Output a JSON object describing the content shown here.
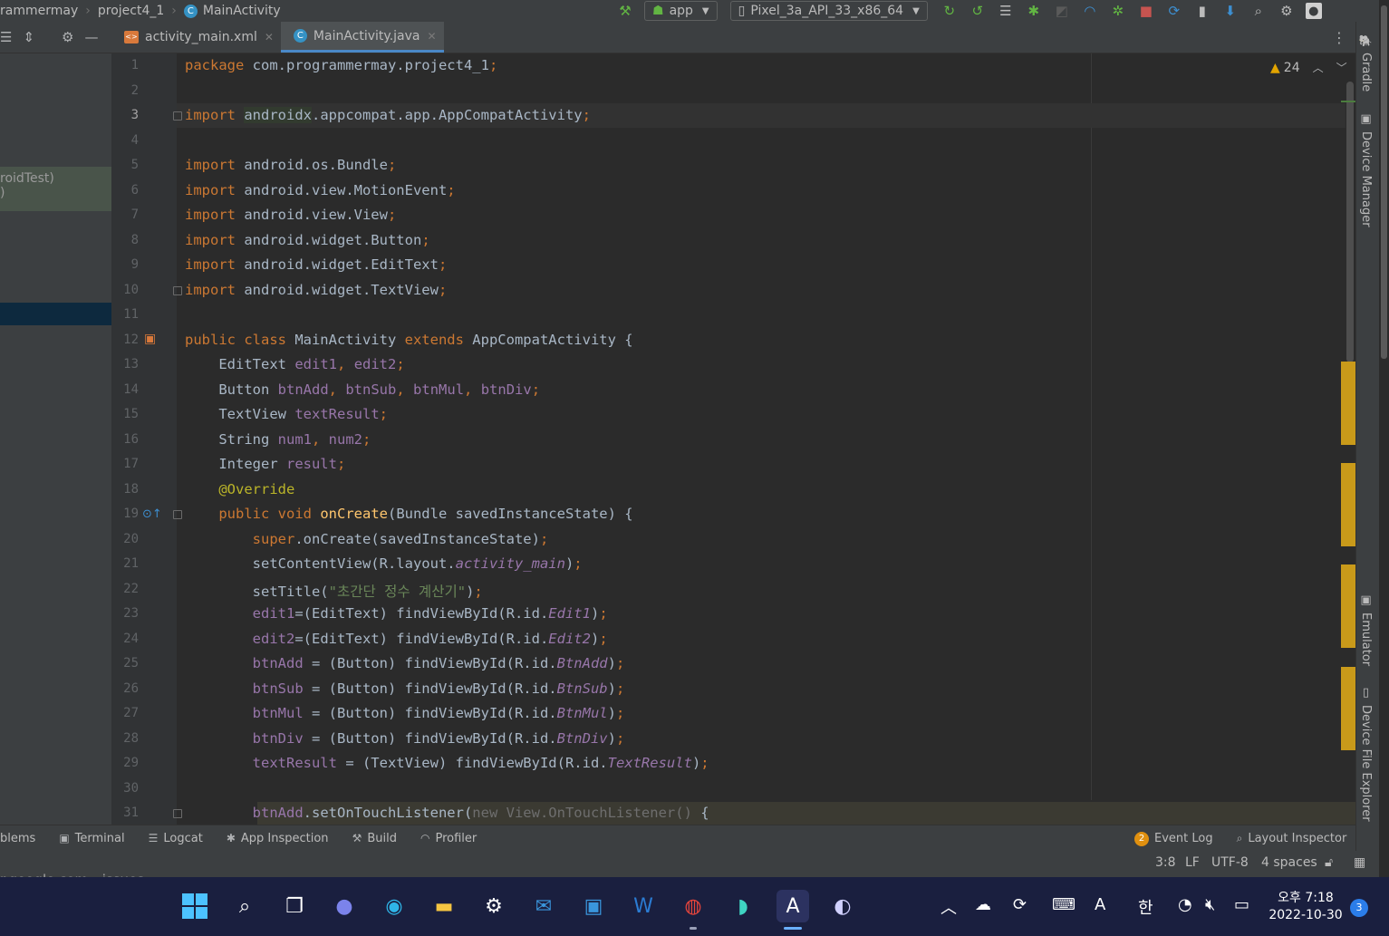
{
  "breadcrumb": [
    "rammermay",
    "project4_1",
    "MainActivity"
  ],
  "toolbar": {
    "run_config": "app",
    "device": "Pixel_3a_API_33_x86_64"
  },
  "left_panel": {
    "test_label": "roidTest)",
    "test_label2": ")"
  },
  "tabs": [
    {
      "label": "activity_main.xml",
      "icon": "xml-layout-icon",
      "active": false
    },
    {
      "label": "MainActivity.java",
      "icon": "java-class-icon",
      "active": true
    }
  ],
  "inspections": {
    "warning_count": "24"
  },
  "lines": [
    {
      "n": "1",
      "html": "<span class=\"k\">package</span> com.programmermay.project4_1<span class=\"k\">;</span>"
    },
    {
      "n": "2",
      "html": ""
    },
    {
      "n": "3",
      "html": "<span class=\"k\">import</span> <span class=\"import-hl\">androidx</span>.appcompat.app.AppCompatActivity<span class=\"k\">;</span>"
    },
    {
      "n": "4",
      "html": ""
    },
    {
      "n": "5",
      "html": "<span class=\"k\">import</span> android.os.Bundle<span class=\"k\">;</span>"
    },
    {
      "n": "6",
      "html": "<span class=\"k\">import</span> android.view.MotionEvent<span class=\"k\">;</span>"
    },
    {
      "n": "7",
      "html": "<span class=\"k\">import</span> android.view.View<span class=\"k\">;</span>"
    },
    {
      "n": "8",
      "html": "<span class=\"k\">import</span> android.widget.Button<span class=\"k\">;</span>"
    },
    {
      "n": "9",
      "html": "<span class=\"k\">import</span> android.widget.EditText<span class=\"k\">;</span>"
    },
    {
      "n": "10",
      "html": "<span class=\"k\">import</span> android.widget.TextView<span class=\"k\">;</span>"
    },
    {
      "n": "11",
      "html": ""
    },
    {
      "n": "12",
      "html": "<span class=\"k\">public class</span> MainActivity <span class=\"k\">extends</span> AppCompatActivity {"
    },
    {
      "n": "13",
      "html": "    EditText <span class=\"f\">edit1</span><span class=\"k\">,</span> <span class=\"f\">edit2</span><span class=\"k\">;</span>"
    },
    {
      "n": "14",
      "html": "    Button <span class=\"f\">btnAdd</span><span class=\"k\">,</span> <span class=\"f\">btnSub</span><span class=\"k\">,</span> <span class=\"f\">btnMul</span><span class=\"k\">,</span> <span class=\"f\">btnDiv</span><span class=\"k\">;</span>"
    },
    {
      "n": "15",
      "html": "    TextView <span class=\"f\">textResult</span><span class=\"k\">;</span>"
    },
    {
      "n": "16",
      "html": "    String <span class=\"f\">num1</span><span class=\"k\">,</span> <span class=\"f\">num2</span><span class=\"k\">;</span>"
    },
    {
      "n": "17",
      "html": "    Integer <span class=\"f\">result</span><span class=\"k\">;</span>"
    },
    {
      "n": "18",
      "html": "    <span class=\"a\">@Override</span>"
    },
    {
      "n": "19",
      "html": "    <span class=\"k\">public void</span> <span class=\"m\">onCreate</span>(Bundle savedInstanceState) {"
    },
    {
      "n": "20",
      "html": "        <span class=\"k\">super</span>.onCreate(savedInstanceState)<span class=\"k\">;</span>"
    },
    {
      "n": "21",
      "html": "        setContentView(R.layout.<span class=\"fi\">activity_main</span>)<span class=\"k\">;</span>"
    },
    {
      "n": "22",
      "html": "        setTitle(<span class=\"s\">\"초간단 정수 계산기\"</span>)<span class=\"k\">;</span>"
    },
    {
      "n": "23",
      "html": "        <span class=\"f\">edit1</span>=(EditText) findViewById(R.id.<span class=\"fi\">Edit1</span>)<span class=\"k\">;</span>"
    },
    {
      "n": "24",
      "html": "        <span class=\"f\">edit2</span>=(EditText) findViewById(R.id.<span class=\"fi\">Edit2</span>)<span class=\"k\">;</span>"
    },
    {
      "n": "25",
      "html": "        <span class=\"f\">btnAdd</span> = (Button) findViewById(R.id.<span class=\"fi\">BtnAdd</span>)<span class=\"k\">;</span>"
    },
    {
      "n": "26",
      "html": "        <span class=\"f\">btnSub</span> = (Button) findViewById(R.id.<span class=\"fi\">BtnSub</span>)<span class=\"k\">;</span>"
    },
    {
      "n": "27",
      "html": "        <span class=\"f\">btnMul</span> = (Button) findViewById(R.id.<span class=\"fi\">BtnMul</span>)<span class=\"k\">;</span>"
    },
    {
      "n": "28",
      "html": "        <span class=\"f\">btnDiv</span> = (Button) findViewById(R.id.<span class=\"fi\">BtnDiv</span>)<span class=\"k\">;</span>"
    },
    {
      "n": "29",
      "html": "        <span class=\"f\">textResult</span> = (TextView) findViewById(R.id.<span class=\"fi\">TextResult</span>)<span class=\"k\">;</span>"
    },
    {
      "n": "30",
      "html": ""
    },
    {
      "n": "31",
      "html": "        <span class=\"f\">btnAdd</span>.setOnTouchListener(<span class=\"g\">new View.OnTouchListener()</span> {"
    }
  ],
  "right_tools": [
    "Gradle",
    "Device Manager",
    "Emulator",
    "Device File Explorer"
  ],
  "bottom_tools": [
    {
      "label": "blems",
      "icon": ""
    },
    {
      "label": "Terminal",
      "icon": "terminal-icon"
    },
    {
      "label": "Logcat",
      "icon": "logcat-icon"
    },
    {
      "label": "App Inspection",
      "icon": "app-inspection-icon"
    },
    {
      "label": "Build",
      "icon": "hammer-icon"
    },
    {
      "label": "Profiler",
      "icon": "gauge-icon"
    }
  ],
  "bottom_right": {
    "event_count": "2",
    "event_log": "Event Log",
    "layout_inspector": "Layout Inspector"
  },
  "status": {
    "caret": "3:8",
    "line_sep": "LF",
    "encoding": "UTF-8",
    "indent": "4 spaces"
  },
  "cut_text": "r.google.com › issues ▾",
  "taskbar": {
    "time": "오후 7:18",
    "date": "2022-10-30",
    "notifications": "3",
    "ime_mode": "A",
    "ime_lang": "한"
  }
}
